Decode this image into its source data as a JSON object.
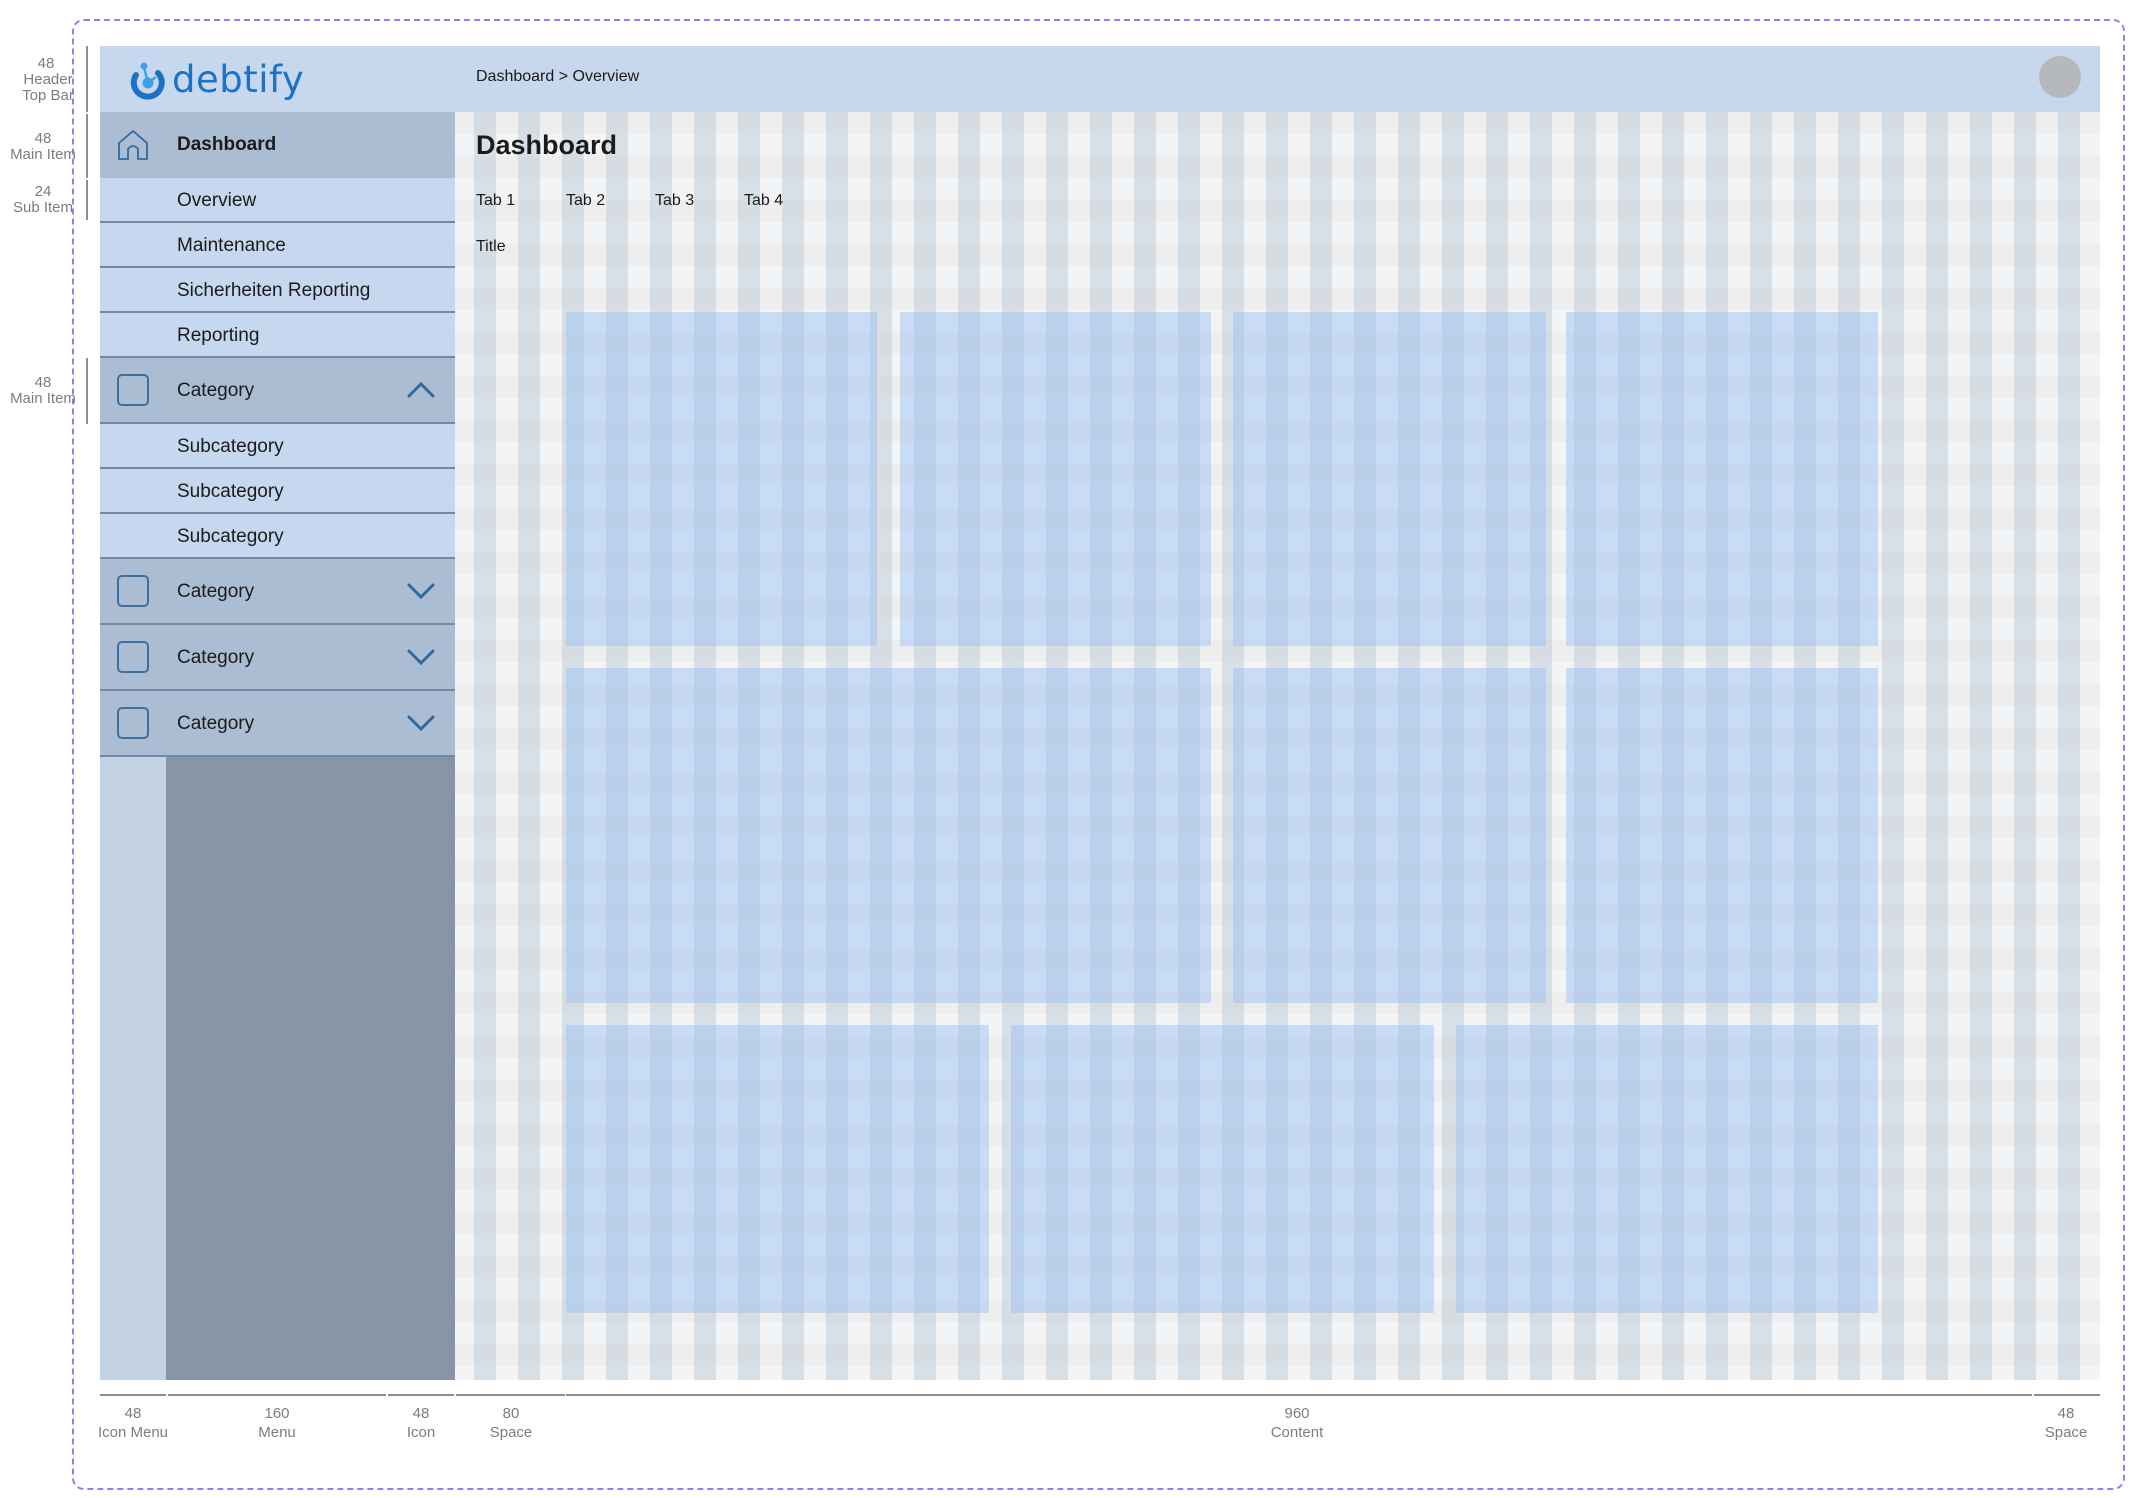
{
  "app": {
    "brand": "debtify"
  },
  "header": {
    "breadcrumb": "Dashboard > Overview",
    "avatar_icon": "user-avatar"
  },
  "sidebar": {
    "main": {
      "label": "Dashboard",
      "icon": "home-icon"
    },
    "sub_items": [
      {
        "label": "Overview"
      },
      {
        "label": "Maintenance"
      },
      {
        "label": "Sicherheiten Reporting"
      },
      {
        "label": "Reporting"
      }
    ],
    "categories": [
      {
        "label": "Category",
        "expanded": true,
        "chevron": "chevron-up-icon",
        "subcategories": [
          {
            "label": "Subcategory"
          },
          {
            "label": "Subcategory"
          },
          {
            "label": "Subcategory"
          }
        ]
      },
      {
        "label": "Category",
        "expanded": false,
        "chevron": "chevron-down-icon"
      },
      {
        "label": "Category",
        "expanded": false,
        "chevron": "chevron-down-icon"
      },
      {
        "label": "Category",
        "expanded": false,
        "chevron": "chevron-down-icon"
      }
    ]
  },
  "main": {
    "title": "Dashboard",
    "tabs": [
      {
        "label": "Tab 1"
      },
      {
        "label": "Tab 2"
      },
      {
        "label": "Tab 3"
      },
      {
        "label": "Tab 4"
      }
    ],
    "section_title": "Title"
  },
  "annotations": {
    "left": [
      {
        "value": "48",
        "label": "Header Top Bar"
      },
      {
        "value": "48",
        "label": "Main Item"
      },
      {
        "value": "24",
        "label": "Sub Item"
      },
      {
        "value": "48",
        "label": "Main Item"
      }
    ],
    "bottom": [
      {
        "value": "48",
        "label": "Icon Menu"
      },
      {
        "value": "160",
        "label": "Menu"
      },
      {
        "value": "48",
        "label": "Icon"
      },
      {
        "value": "80",
        "label": "Space"
      },
      {
        "value": "960",
        "label": "Content"
      },
      {
        "value": "48",
        "label": "Space"
      }
    ]
  },
  "colors": {
    "brand": "#1d72c4",
    "accent_icon": "#2f6a9e",
    "frame_dashed": "#8f80f0",
    "topbar": "#c7d8ee",
    "sidebar_main": "#aabdd2",
    "sidebar_sub": "#c5d8ef",
    "sidebar_dark": "#8795a6"
  }
}
